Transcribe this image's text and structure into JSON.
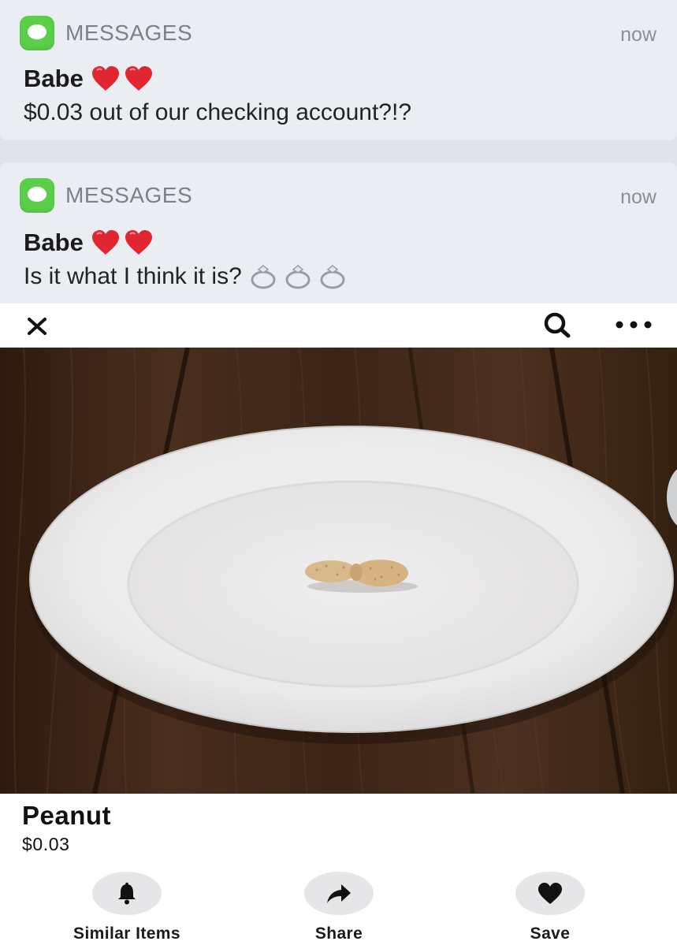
{
  "notifications": [
    {
      "app_name": "MESSAGES",
      "time": "now",
      "sender": "Babe",
      "sender_emoji": [
        "red-heart",
        "red-heart"
      ],
      "message": "$0.03 out of our checking account?!?",
      "message_emoji": []
    },
    {
      "app_name": "MESSAGES",
      "time": "now",
      "sender": "Babe",
      "sender_emoji": [
        "red-heart",
        "red-heart"
      ],
      "message": "Is it what I think it is?",
      "message_emoji": [
        "ring",
        "ring",
        "ring"
      ]
    }
  ],
  "header": {
    "icons": [
      "close-icon",
      "search-icon",
      "more-icon"
    ]
  },
  "listing": {
    "image_subject": "plate-with-peanut",
    "title": "Peanut",
    "price": "$0.03"
  },
  "actions": [
    {
      "label": "Similar Items",
      "icon": "bell-icon"
    },
    {
      "label": "Share",
      "icon": "share-arrow-icon"
    },
    {
      "label": "Save",
      "icon": "heart-icon"
    }
  ],
  "colors": {
    "messages_green": "#5ccf4a",
    "notification_bg": "#eaedf2",
    "heart_red": "#e0262f",
    "action_circle": "#e6e6e9"
  }
}
